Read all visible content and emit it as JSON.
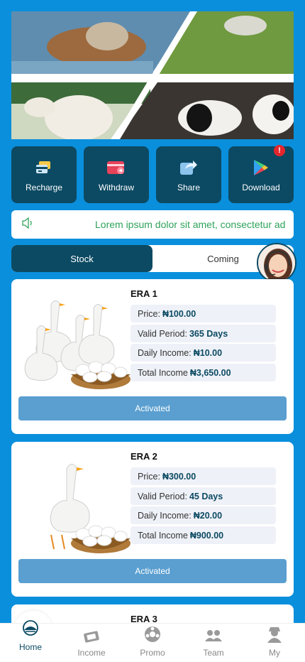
{
  "actions": [
    {
      "label": "Recharge",
      "icon": "recharge-card-icon"
    },
    {
      "label": "Withdraw",
      "icon": "wallet-icon"
    },
    {
      "label": "Share",
      "icon": "share-icon"
    },
    {
      "label": "Download",
      "icon": "play-store-icon",
      "badge": "!"
    }
  ],
  "notice": {
    "text": "Lorem ipsum dolor sit amet, consectetur ad"
  },
  "tabs": [
    {
      "label": "Stock"
    },
    {
      "label": "Coming"
    }
  ],
  "products": [
    {
      "title": "ERA 1",
      "price_label": "Price:",
      "price": "₦100.00",
      "period_label": "Valid Period:",
      "period": "365 Days",
      "daily_label": "Daily Income:",
      "daily": "₦10.00",
      "total_label": "Total Income",
      "total": "₦3,650.00",
      "button": "Activated"
    },
    {
      "title": "ERA 2",
      "price_label": "Price:",
      "price": "₦300.00",
      "period_label": "Valid Period:",
      "period": "45 Days",
      "daily_label": "Daily Income:",
      "daily": "₦20.00",
      "total_label": "Total Income",
      "total": "₦900.00",
      "button": "Activated"
    },
    {
      "title": "ERA 3"
    }
  ],
  "nav": [
    {
      "label": "Home",
      "icon": "home-logo-icon"
    },
    {
      "label": "Income",
      "icon": "income-icon"
    },
    {
      "label": "Promo",
      "icon": "promo-icon"
    },
    {
      "label": "Team",
      "icon": "team-icon"
    },
    {
      "label": "My",
      "icon": "profile-icon"
    }
  ],
  "colors": {
    "background": "#0a8fdc",
    "primary": "#0c4a63",
    "button": "#5a9fd0",
    "notice_text": "#2fa35b",
    "badge": "#e5262c"
  }
}
